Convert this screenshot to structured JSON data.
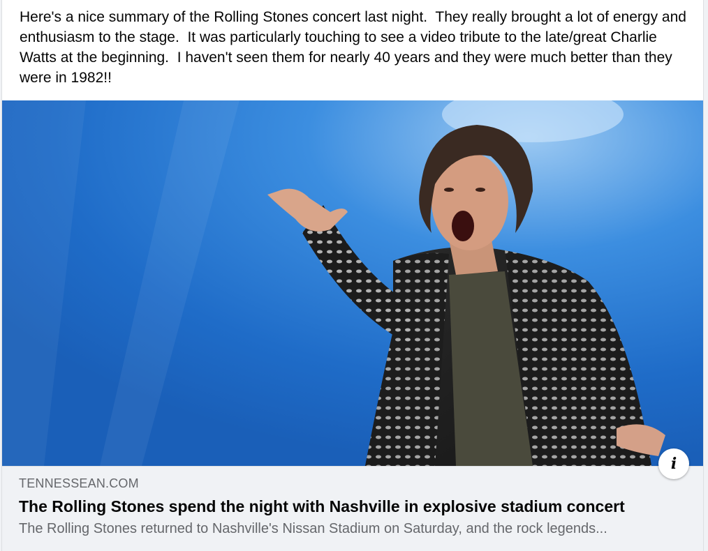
{
  "post": {
    "text": "Here's a nice summary of the Rolling Stones concert last night.  They really brought a lot of energy and enthusiasm to the stage.  It was particularly touching to see a video tribute to the late/great Charlie Watts at the beginning.  I haven't seen them for nearly 40 years and they were much better than they were in 1982!!"
  },
  "media": {
    "icon": "concert-photo-singer",
    "background_color": "#2b7fd8"
  },
  "link_preview": {
    "domain": "TENNESSEAN.COM",
    "headline": "The Rolling Stones spend the night with Nashville in explosive stadium concert",
    "description": "The Rolling Stones returned to Nashville's Nissan Stadium on Saturday, and the rock legends...",
    "info_icon": "info-icon",
    "info_glyph": "i"
  }
}
